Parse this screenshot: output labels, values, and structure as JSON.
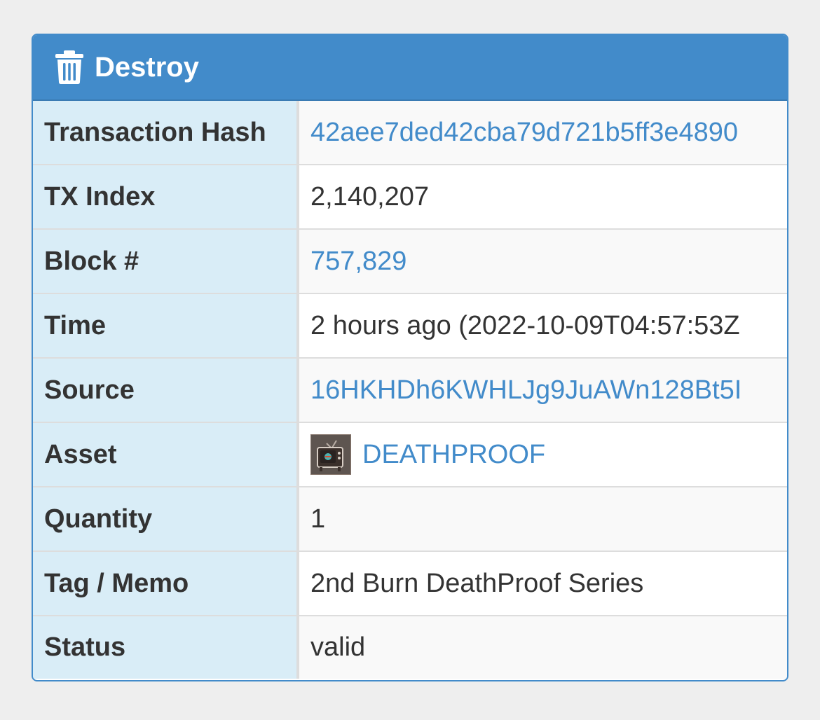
{
  "panel": {
    "title": "Destroy",
    "icon": "trash-icon",
    "header_color": "#428bca",
    "label_bg": "#d9edf7",
    "link_color": "#428bca"
  },
  "rows": [
    {
      "label": "Transaction Hash",
      "value": "42aee7ded42cba79d721b5ff3e4890",
      "is_link": true
    },
    {
      "label": "TX Index",
      "value": "2,140,207",
      "is_link": false
    },
    {
      "label": "Block #",
      "value": "757,829",
      "is_link": true
    },
    {
      "label": "Time",
      "value": "2 hours ago (2022-10-09T04:57:53Z",
      "is_link": false
    },
    {
      "label": "Source",
      "value": "16HKHDh6KWHLJg9JuAWn128Bt5I",
      "is_link": true
    },
    {
      "label": "Asset",
      "value": "DEATHPROOF",
      "is_link": true,
      "icon": "asset-thumbnail-tv-icon"
    },
    {
      "label": "Quantity",
      "value": "1",
      "is_link": false
    },
    {
      "label": "Tag / Memo",
      "value": "2nd Burn DeathProof Series",
      "is_link": false
    },
    {
      "label": "Status",
      "value": "valid",
      "is_link": false
    }
  ]
}
